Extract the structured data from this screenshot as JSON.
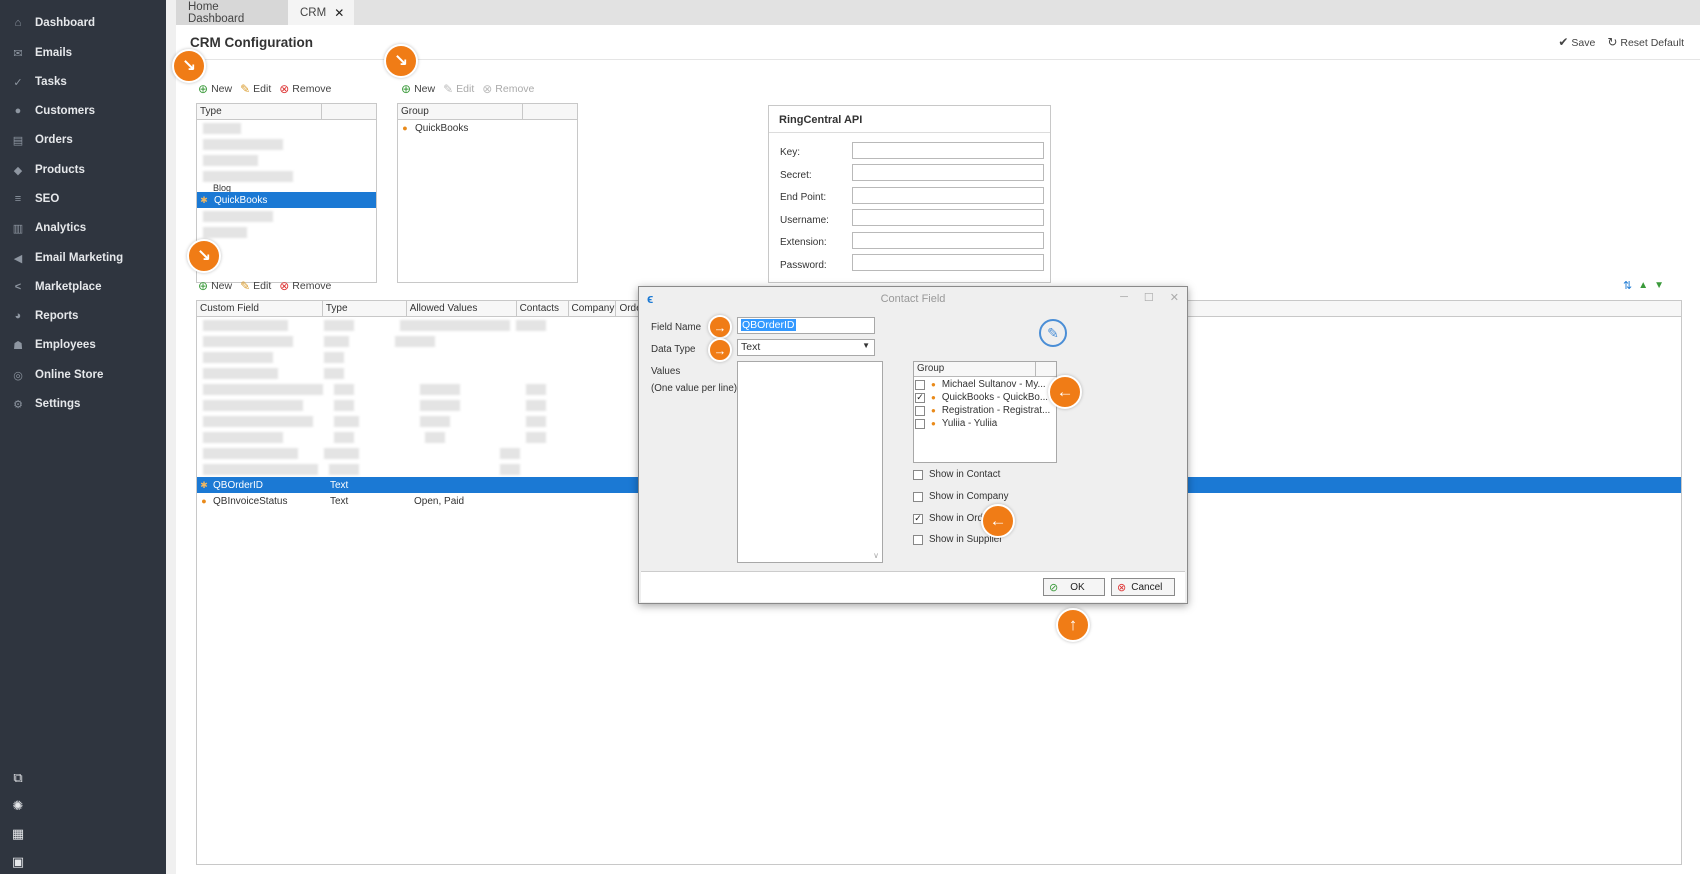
{
  "sidebar": {
    "items": [
      {
        "label": "Dashboard",
        "icon": "home-icon"
      },
      {
        "label": "Emails",
        "icon": "envelope-icon"
      },
      {
        "label": "Tasks",
        "icon": "tasks-icon"
      },
      {
        "label": "Customers",
        "icon": "user-icon"
      },
      {
        "label": "Orders",
        "icon": "cart-icon"
      },
      {
        "label": "Products",
        "icon": "tag-icon"
      },
      {
        "label": "SEO",
        "icon": "sliders-icon"
      },
      {
        "label": "Analytics",
        "icon": "bar-chart-icon"
      },
      {
        "label": "Email Marketing",
        "icon": "megaphone-icon"
      },
      {
        "label": "Marketplace",
        "icon": "share-icon"
      },
      {
        "label": "Reports",
        "icon": "pie-icon"
      },
      {
        "label": "Employees",
        "icon": "users-icon"
      },
      {
        "label": "Online Store",
        "icon": "globe-icon"
      },
      {
        "label": "Settings",
        "icon": "search-gear-icon"
      }
    ]
  },
  "tabs": {
    "home": "Home Dashboard",
    "crm": "CRM",
    "close": "✕"
  },
  "header": {
    "title": "CRM Configuration",
    "save": "Save",
    "reset": "Reset Default"
  },
  "toolbar": {
    "new": "New",
    "edit": "Edit",
    "remove": "Remove"
  },
  "type_grid": {
    "col_type": "Type",
    "partial_text": "Blog",
    "selected": "QuickBooks"
  },
  "group_grid": {
    "col_group": "Group",
    "row": "QuickBooks"
  },
  "ringcentral": {
    "title": "RingCentral API",
    "labels": [
      "Key:",
      "Secret:",
      "End Point:",
      "Username:",
      "Extension:",
      "Password:"
    ]
  },
  "fields_grid": {
    "columns": [
      "Custom Field",
      "Type",
      "Allowed Values",
      "Contacts",
      "Company",
      "Orde"
    ],
    "rows": [
      {
        "name": "QBOrderID",
        "type": "Text",
        "values": ""
      },
      {
        "name": "QBInvoiceStatus",
        "type": "Text",
        "values": "Open, Paid"
      }
    ]
  },
  "dialog": {
    "title_a": "Contact",
    "title_b": "Field",
    "field_name_label": "Field Name",
    "field_name_value": "QBOrderID",
    "data_type_label": "Data Type",
    "data_type_value": "Text",
    "values_label": "Values",
    "values_hint": "(One value per line)",
    "group_col": "Group",
    "groups": [
      {
        "label": "Michael Sultanov - My...",
        "checked": false
      },
      {
        "label": "QuickBooks - QuickBo...",
        "checked": true
      },
      {
        "label": "Registration - Registrat...",
        "checked": false
      },
      {
        "label": "Yuliia - Yuliia",
        "checked": false
      }
    ],
    "show_contact": "Show in Contact",
    "show_company": "Show in Company",
    "show_order": "Show in Order",
    "show_supplier": "Show in Supplier",
    "ok": "OK",
    "cancel": "Cancel"
  },
  "colors": {
    "sidebar_bg": "#2f353f",
    "accent": "#1b79d4",
    "callout": "#f07c16"
  }
}
